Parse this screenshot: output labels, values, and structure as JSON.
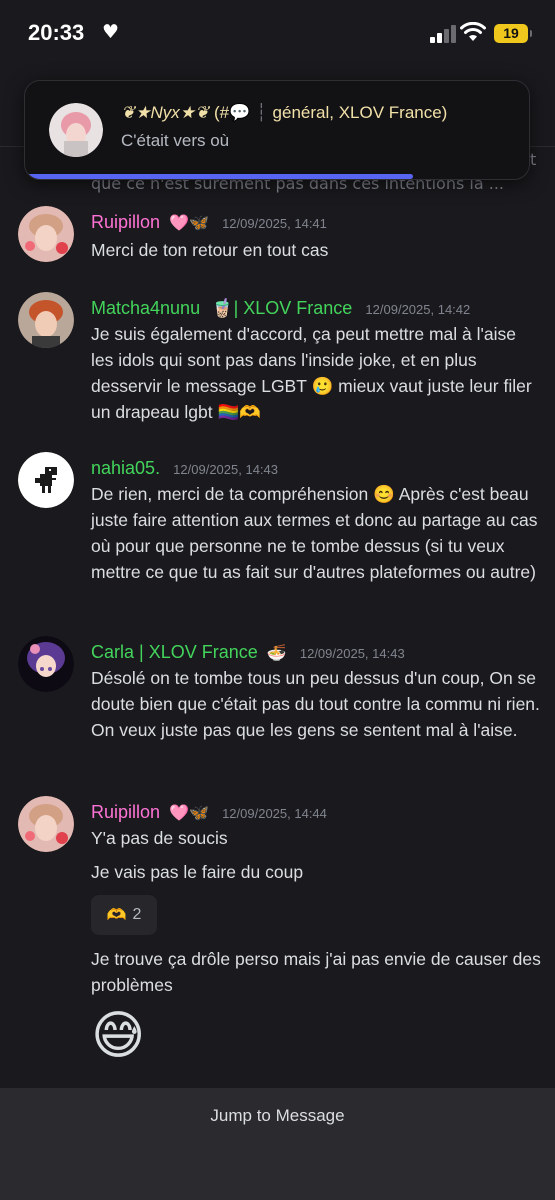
{
  "status_bar": {
    "time": "20:33",
    "heart": "♥",
    "battery": "19"
  },
  "notification": {
    "author": "❦★Nyx★❦",
    "channel_prefix": "(#💬",
    "channel_suffix": "général, XLOV France)",
    "body": "C'était vers où",
    "progress": 0.77,
    "avatar_icon": "avatar-pink-hair"
  },
  "partial_previous_line": "que ce n'est sûrement pas dans ces intentions la ...",
  "messages": [
    {
      "author": "Ruipillon",
      "author_badges": "🩷🦋",
      "timestamp": "12/09/2025, 14:41",
      "lines": [
        "Merci de ton retour en tout cas"
      ]
    },
    {
      "author": "Matcha4nunu",
      "author_badges": "🧋| XLOV France",
      "timestamp": "12/09/2025, 14:42",
      "text": "Je suis également d'accord, ça peut mettre mal à l'aise les idols qui sont pas dans l'inside joke, et en plus desservir le message LGBT 🥲 mieux vaut juste leur filer un drapeau lgbt 🏳️‍🌈🫶"
    },
    {
      "author": "nahia05.",
      "timestamp": "12/09/2025, 14:43",
      "text": "De rien, merci de ta compréhension 😊 Après c'est beau juste faire attention aux termes et donc au partage au cas où pour que personne ne te tombe dessus (si tu veux mettre ce que tu as fait sur d'autres plateformes ou autre)"
    },
    {
      "author": "Carla | XLOV France",
      "author_badges": "🍜",
      "timestamp": "12/09/2025, 14:43",
      "text": "Désolé on te tombe tous un peu dessus d'un coup, On se doute bien que c'était pas du tout contre la commu ni rien. On veux juste pas que les gens se sentent mal à l'aise."
    },
    {
      "author": "Ruipillon",
      "author_badges": "🩷🦋",
      "timestamp": "12/09/2025, 14:44",
      "lines": [
        "Y'a pas de soucis",
        "Je vais pas le faire du coup"
      ],
      "reaction_emoji": "🫶",
      "reaction_count": "2",
      "followup": "Je trouve ça drôle perso mais j'ai pas envie de causer des problèmes",
      "big_emoji": "😅"
    }
  ],
  "jump_bar": {
    "label": "Jump to Message"
  },
  "colors": {
    "background": "#1a1a1e",
    "accent": "#5865f2",
    "name_pink": "#ff73d5",
    "name_green": "#43d45b"
  }
}
